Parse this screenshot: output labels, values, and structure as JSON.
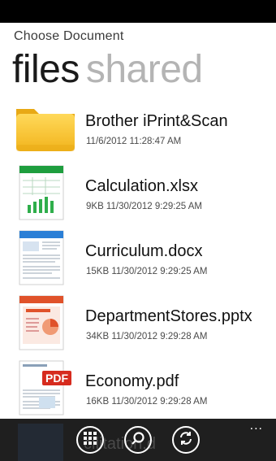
{
  "header": {
    "subtitle": "Choose Document",
    "pivot_active": "files",
    "pivot_inactive": "shared"
  },
  "files": [
    {
      "name": "Brother iPrint&Scan",
      "meta": "11/6/2012 11:28:47 AM",
      "icon": "folder-icon"
    },
    {
      "name": "Calculation.xlsx",
      "meta": "9KB 11/30/2012 9:29:25 AM",
      "icon": "excel-file-icon"
    },
    {
      "name": "Curriculum.docx",
      "meta": "15KB 11/30/2012 9:29:25 AM",
      "icon": "word-file-icon"
    },
    {
      "name": "DepartmentStores.pptx",
      "meta": "34KB 11/30/2012 9:29:28 AM",
      "icon": "powerpoint-file-icon"
    },
    {
      "name": "Economy.pdf",
      "meta": "16KB 11/30/2012 9:29:28 AM",
      "icon": "pdf-file-icon",
      "badge": "PDF"
    }
  ],
  "app_bar": {
    "peek_text": "cilitation.d",
    "buttons": [
      "grid-icon",
      "search-icon",
      "sync-icon"
    ],
    "more": "..."
  },
  "colors": {
    "folder": "#f7c02b",
    "excel": "#1e9e3e",
    "word": "#2b7fd6",
    "powerpoint": "#e0522a",
    "pdf": "#d62b1e",
    "app_bar": "#1f1f1f"
  }
}
